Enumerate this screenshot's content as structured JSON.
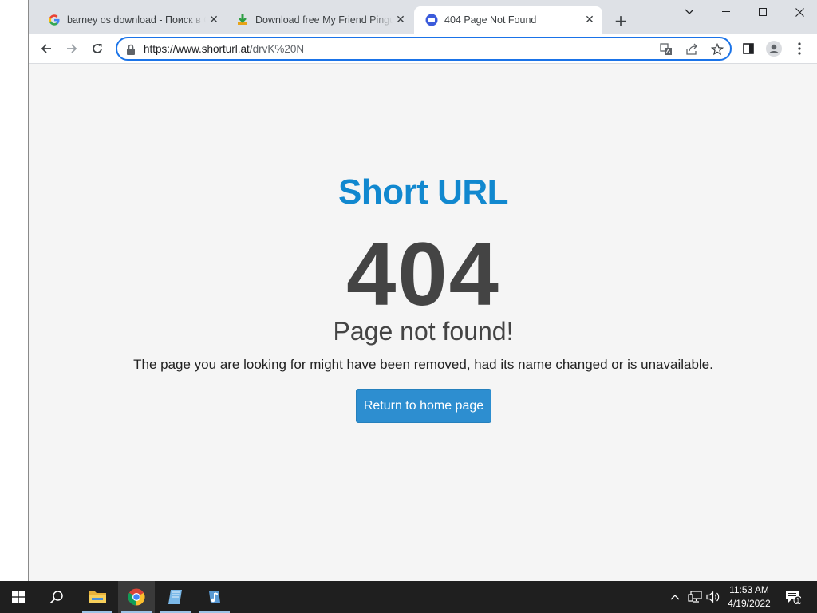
{
  "browser": {
    "tabs": [
      {
        "title": "barney os download - Поиск в Google",
        "favicon": "google-g-icon",
        "active": false
      },
      {
        "title": "Download free My Friend Pingu",
        "favicon": "download-arrow-icon",
        "active": false
      },
      {
        "title": "404 Page Not Found",
        "favicon": "chat-bubble-icon",
        "active": true
      }
    ],
    "new_tab_label": "+",
    "address_bar": {
      "url_host": "https://www.shorturl.at",
      "url_path": "/drvK%20N"
    }
  },
  "page": {
    "brand": "Short URL",
    "error_code": "404",
    "heading": "Page not found!",
    "message": "The page you are looking for might have been removed, had its name changed or is unavailable.",
    "home_button": "Return to home page"
  },
  "taskbar": {
    "time": "11:53 AM",
    "date": "4/19/2022",
    "notification_count": "1",
    "apps": [
      "start-icon",
      "search-icon",
      "file-explorer-icon",
      "chrome-icon",
      "notepad-icon",
      "music-app-icon"
    ]
  },
  "colors": {
    "brand": "#1188cf",
    "button": "#2d8ed0",
    "text_dark": "#444444",
    "page_bg": "#f5f5f5",
    "omnibox_focus": "#1a73e8"
  }
}
